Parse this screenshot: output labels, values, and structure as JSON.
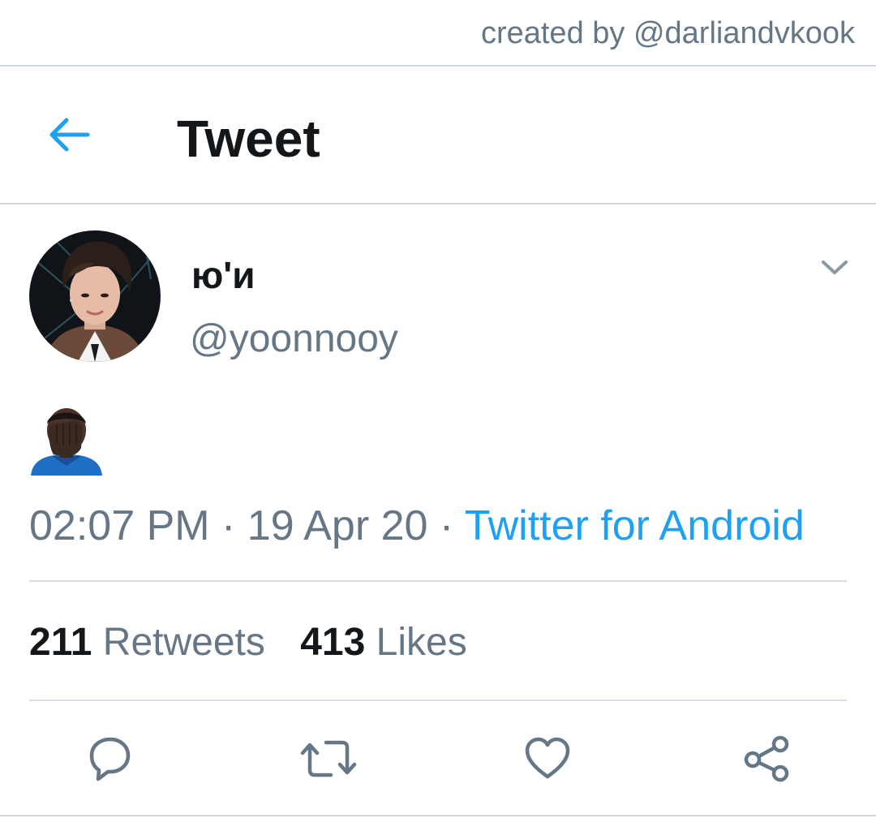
{
  "credit": {
    "text": "created by @darliandvkook"
  },
  "header": {
    "title": "Tweet",
    "back_icon": "arrow-left-icon"
  },
  "tweet": {
    "display_name": "ю'и",
    "handle": "@yoonnooy",
    "body_emoji": "face-palm-emoji",
    "time": "02:07 PM",
    "separator": " · ",
    "date": "19 Apr 20",
    "source": "Twitter for Android",
    "retweets_count": "211",
    "retweets_label": "Retweets",
    "likes_count": "413",
    "likes_label": "Likes"
  },
  "actions": {
    "reply_icon": "reply-icon",
    "retweet_icon": "retweet-icon",
    "like_icon": "heart-icon",
    "share_icon": "share-icon"
  },
  "colors": {
    "accent": "#1da1f2",
    "muted": "#657786",
    "text": "#14171a",
    "divider": "#d7dde3"
  }
}
